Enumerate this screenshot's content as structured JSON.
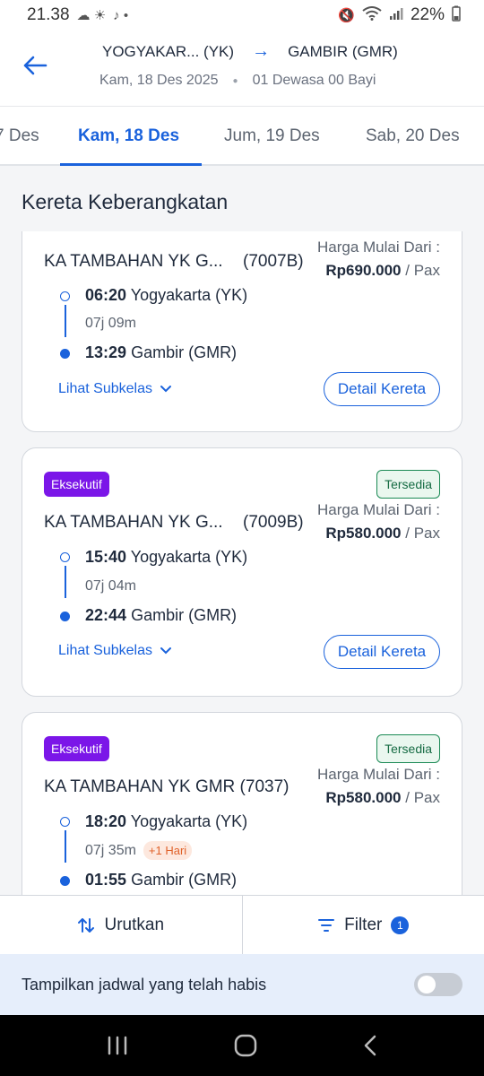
{
  "status_bar": {
    "time": "21.38",
    "battery": "22%"
  },
  "header": {
    "origin": "YOGYAKAR... (YK)",
    "destination": "GAMBIR (GMR)",
    "date": "Kam, 18 Des 2025",
    "passengers": "01 Dewasa 00 Bayi"
  },
  "tabs": [
    "7 Des",
    "Kam, 18 Des",
    "Jum, 19 Des",
    "Sab, 20 Des"
  ],
  "section_title": "Kereta Keberangkatan",
  "price_label": "Harga Mulai Dari :",
  "per_pax": "/ Pax",
  "subkelas_label": "Lihat Subkelas",
  "detail_label": "Detail Kereta",
  "trains": [
    {
      "class": "",
      "availability": "",
      "name": "KA TAMBAHAN YK G...",
      "number": "(7007B)",
      "price": "Rp690.000",
      "depart_time": "06:20",
      "depart_station": "Yogyakarta (YK)",
      "duration": "07j 09m",
      "next_day": "",
      "arrive_time": "13:29",
      "arrive_station": "Gambir (GMR)"
    },
    {
      "class": "Eksekutif",
      "availability": "Tersedia",
      "name": "KA TAMBAHAN YK G...",
      "number": "(7009B)",
      "price": "Rp580.000",
      "depart_time": "15:40",
      "depart_station": "Yogyakarta (YK)",
      "duration": "07j 04m",
      "next_day": "",
      "arrive_time": "22:44",
      "arrive_station": "Gambir (GMR)"
    },
    {
      "class": "Eksekutif",
      "availability": "Tersedia",
      "name": "KA TAMBAHAN YK GMR (7037)",
      "number": "",
      "price": "Rp580.000",
      "depart_time": "18:20",
      "depart_station": "Yogyakarta (YK)",
      "duration": "07j 35m",
      "next_day": "+1 Hari",
      "arrive_time": "01:55",
      "arrive_station": "Gambir (GMR)"
    }
  ],
  "bottom_bar": {
    "sort_label": "Urutkan",
    "filter_label": "Filter",
    "filter_count": "1"
  },
  "toggle_row": {
    "label": "Tampilkan jadwal yang telah habis",
    "enabled": false
  },
  "colors": {
    "primary": "#1a62dc",
    "class_badge": "#7b16e8",
    "available": "#1b8a55",
    "next_day": "#e0622a"
  },
  "icons": [
    "back-arrow-icon",
    "route-arrow-icon",
    "chevron-down-icon",
    "sort-icon",
    "filter-icon",
    "recent-apps-icon",
    "home-icon",
    "back-nav-icon"
  ]
}
